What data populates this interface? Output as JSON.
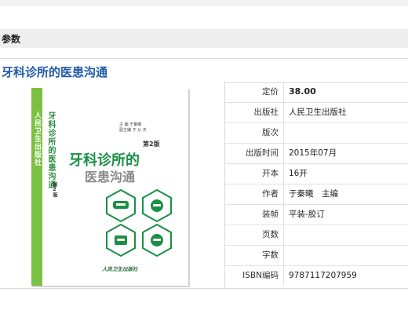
{
  "section": {
    "title": "参数"
  },
  "book": {
    "title": "牙科诊所的医患沟通"
  },
  "cover": {
    "spine_text": "人民卫生出版社",
    "vertical_title": "牙科诊所的医患沟通",
    "edition": "第2版",
    "title_line1": "牙科诊所的",
    "title_line2": "医患沟通",
    "editor_line1": "主 编  于秦曦",
    "editor_line2": "副主编  于 从 杰",
    "publisher": "人民卫生出版社",
    "vertical_small": "第2版",
    "accent_color": "#1a8f46",
    "spine_color": "#7ac142"
  },
  "params": [
    {
      "key": "定价",
      "value": "38.00"
    },
    {
      "key": "出版社",
      "value": "人民卫生出版社"
    },
    {
      "key": "版次",
      "value": ""
    },
    {
      "key": "出版时间",
      "value": "2015年07月"
    },
    {
      "key": "开本",
      "value": "16开"
    },
    {
      "key": "作者",
      "value": "于秦曦　主编"
    },
    {
      "key": "装帧",
      "value": "平装-胶订"
    },
    {
      "key": "页数",
      "value": ""
    },
    {
      "key": "字数",
      "value": ""
    },
    {
      "key": "ISBN编码",
      "value": "9787117207959"
    }
  ]
}
